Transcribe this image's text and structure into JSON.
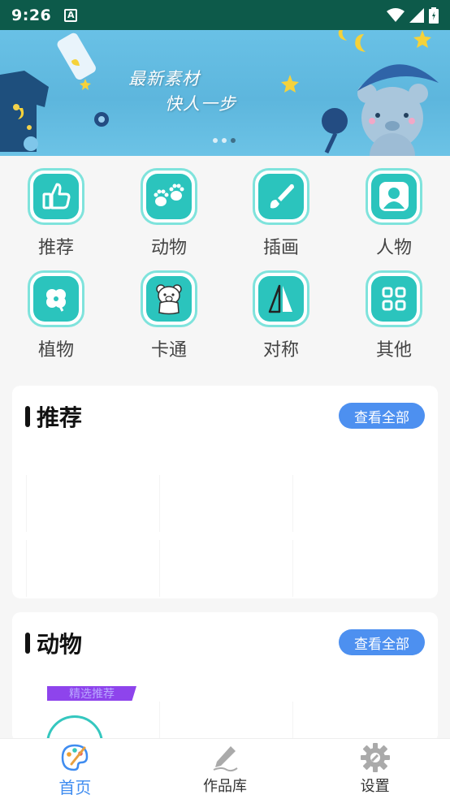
{
  "status_bar": {
    "time": "9:26",
    "notification_icon": "A"
  },
  "banner": {
    "line1": "最新素材",
    "line2": "快人一步",
    "slides": 3,
    "active_slide": 3
  },
  "categories": [
    {
      "label": "推荐",
      "icon": "thumbs-up-icon"
    },
    {
      "label": "动物",
      "icon": "paw-icon"
    },
    {
      "label": "插画",
      "icon": "brush-icon"
    },
    {
      "label": "人物",
      "icon": "person-icon"
    },
    {
      "label": "植物",
      "icon": "clover-icon"
    },
    {
      "label": "卡通",
      "icon": "cartoon-bear-icon"
    },
    {
      "label": "对称",
      "icon": "triangle-icon"
    },
    {
      "label": "其他",
      "icon": "grid-icon"
    }
  ],
  "sections": [
    {
      "title": "推荐",
      "view_all": "查看全部"
    },
    {
      "title": "动物",
      "view_all": "查看全部",
      "badge": "精选推荐"
    }
  ],
  "bottom_nav": [
    {
      "label": "首页",
      "icon": "palette-icon",
      "active": true
    },
    {
      "label": "作品库",
      "icon": "pencil-icon",
      "active": false
    },
    {
      "label": "设置",
      "icon": "gear-icon",
      "active": false
    }
  ],
  "colors": {
    "accent": "#2bc4bd",
    "button": "#4d90f0",
    "status_bar": "#0d5a4a",
    "nav_active": "#3f8cf0"
  }
}
